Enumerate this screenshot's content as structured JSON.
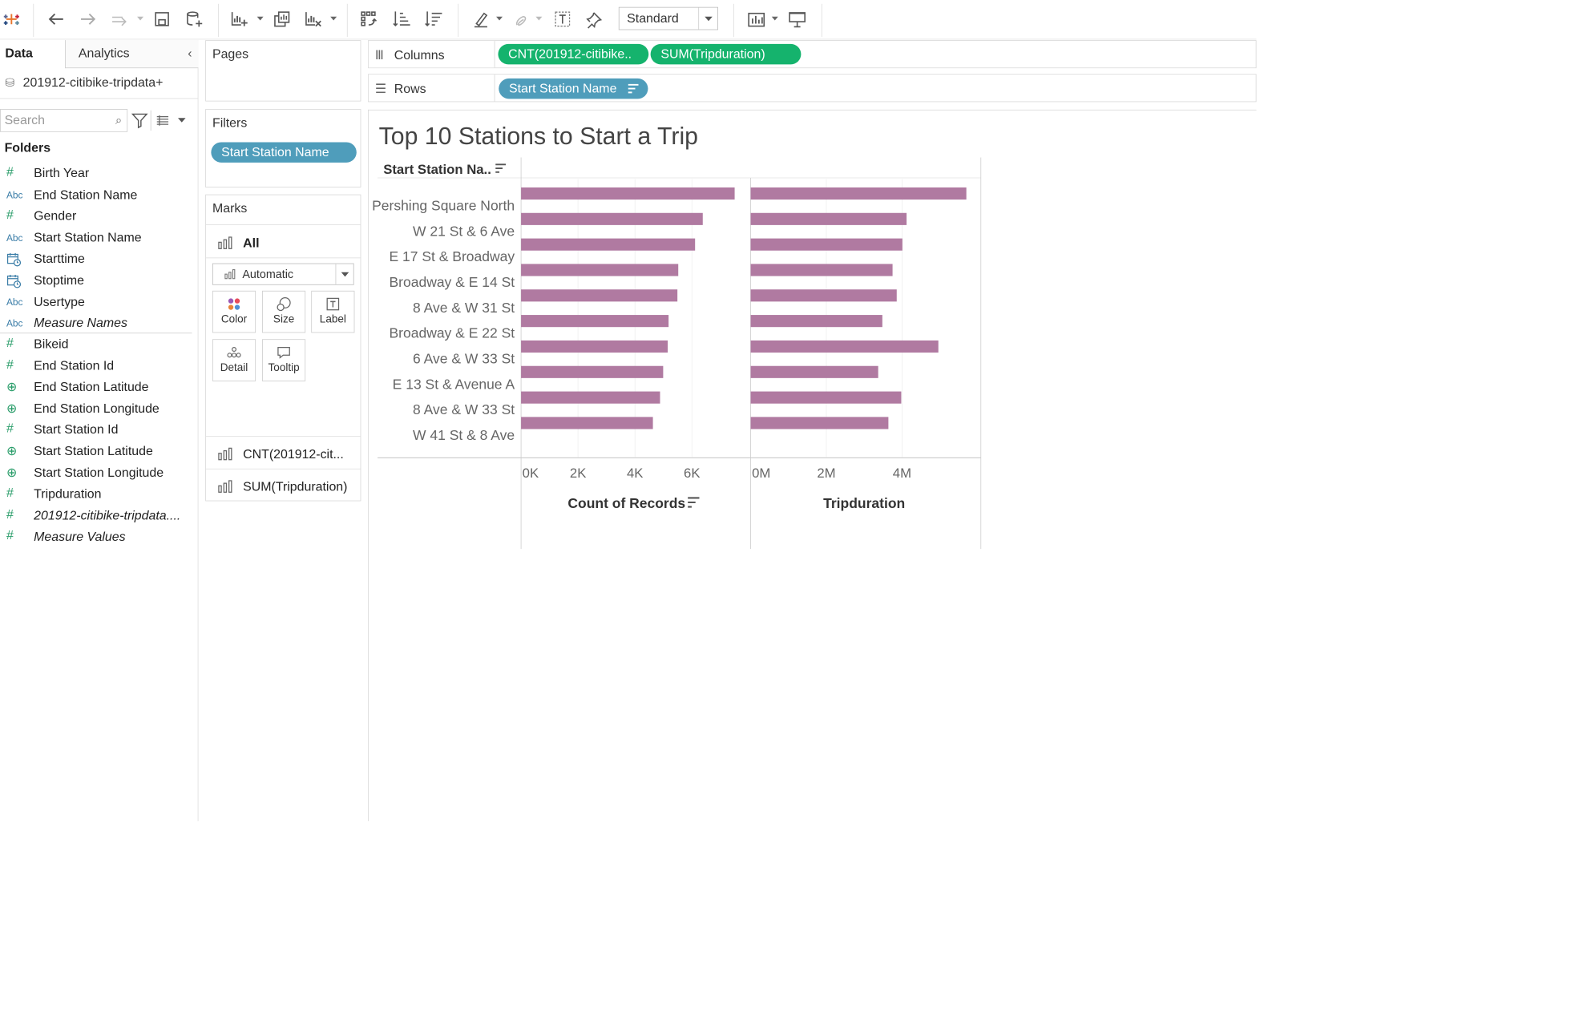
{
  "toolbar": {
    "view_mode": "Standard",
    "icons": [
      "tableau-logo-icon",
      "undo-icon",
      "redo-icon",
      "replay-icon",
      "save-icon",
      "new-datasource-icon",
      "new-worksheet-icon",
      "duplicate-sheet-icon",
      "clear-sheet-icon",
      "swap-icon",
      "sort-ascending-icon",
      "sort-descending-icon",
      "highlight-icon",
      "annotate-icon",
      "show-title-icon",
      "pin-icon",
      "show-me-icon",
      "presentation-icon"
    ]
  },
  "data_pane": {
    "tabs": {
      "data": "Data",
      "analytics": "Analytics"
    },
    "datasource": "201912-citibike-tripdata+",
    "search_placeholder": "Search",
    "folders_heading": "Folders",
    "dimensions": [
      {
        "icon": "#",
        "type": "num",
        "label": "Birth Year"
      },
      {
        "icon": "Abc",
        "type": "abc",
        "label": "End Station Name"
      },
      {
        "icon": "#",
        "type": "num",
        "label": "Gender"
      },
      {
        "icon": "Abc",
        "type": "abc",
        "label": "Start Station Name"
      },
      {
        "icon": "date",
        "type": "date",
        "label": "Starttime"
      },
      {
        "icon": "date",
        "type": "date",
        "label": "Stoptime"
      },
      {
        "icon": "Abc",
        "type": "abc",
        "label": "Usertype"
      },
      {
        "icon": "Abc",
        "type": "abc",
        "label": "Measure Names",
        "italic": true
      }
    ],
    "measures": [
      {
        "icon": "#",
        "type": "num",
        "label": "Bikeid"
      },
      {
        "icon": "#",
        "type": "num",
        "label": "End Station Id"
      },
      {
        "icon": "geo",
        "type": "geo",
        "label": "End Station Latitude"
      },
      {
        "icon": "geo",
        "type": "geo",
        "label": "End Station Longitude"
      },
      {
        "icon": "#",
        "type": "num",
        "label": "Start Station Id"
      },
      {
        "icon": "geo",
        "type": "geo",
        "label": "Start Station Latitude"
      },
      {
        "icon": "geo",
        "type": "geo",
        "label": "Start Station Longitude"
      },
      {
        "icon": "#",
        "type": "num",
        "label": "Tripduration"
      },
      {
        "icon": "#",
        "type": "num",
        "label": "201912-citibike-tripdata....",
        "italic": true
      },
      {
        "icon": "#",
        "type": "num",
        "label": "Measure Values",
        "italic": true
      }
    ]
  },
  "pages": {
    "heading": "Pages"
  },
  "filters": {
    "heading": "Filters",
    "pill": "Start Station Name"
  },
  "marks": {
    "heading": "Marks",
    "all_label": "All",
    "mark_type": "Automatic",
    "buttons": [
      "Color",
      "Size",
      "Label",
      "Detail",
      "Tooltip"
    ],
    "measures": [
      "CNT(201912-cit...",
      "SUM(Tripduration)"
    ]
  },
  "shelves": {
    "columns_label": "Columns",
    "columns_pills": [
      "CNT(201912-citibike..",
      "SUM(Tripduration)"
    ],
    "rows_label": "Rows",
    "rows_pills": [
      "Start Station Name"
    ]
  },
  "viz": {
    "title": "Top 10 Stations to Start a Trip",
    "row_header": "Start Station Na..",
    "bar_color": "#b07aa1"
  },
  "chart_data": {
    "type": "bar",
    "title": "Top 10 Stations to Start a Trip",
    "orientation": "horizontal",
    "categories": [
      "Pershing Square North",
      "W 21 St & 6 Ave",
      "E 17 St & Broadway",
      "Broadway & E 14 St",
      "8 Ave & W 31 St",
      "Broadway & E 22 St",
      "6 Ave & W 33 St",
      "E 13 St & Avenue A",
      "8 Ave & W 33 St",
      "W 41 St & 8 Ave"
    ],
    "panels": [
      {
        "xlabel": "Count of Records",
        "ticks": [
          "0K",
          "2K",
          "4K",
          "6K"
        ],
        "tick_values": [
          0,
          2000,
          4000,
          6000
        ],
        "xlim": [
          0,
          7950
        ],
        "series": [
          {
            "values": [
              7500,
              6380,
              6110,
              5520,
              5490,
              5180,
              5150,
              4990,
              4880,
              4630
            ]
          }
        ]
      },
      {
        "xlabel": "Tripduration",
        "ticks": [
          "0M",
          "2M",
          "4M"
        ],
        "tick_values": [
          0,
          2000000,
          4000000
        ],
        "xlim": [
          0,
          6000000
        ],
        "series": [
          {
            "values": [
              5700000,
              4120000,
              4010000,
              3750000,
              3860000,
              3480000,
              4960000,
              3370000,
              3980000,
              3640000
            ]
          }
        ]
      }
    ],
    "grid": true
  }
}
